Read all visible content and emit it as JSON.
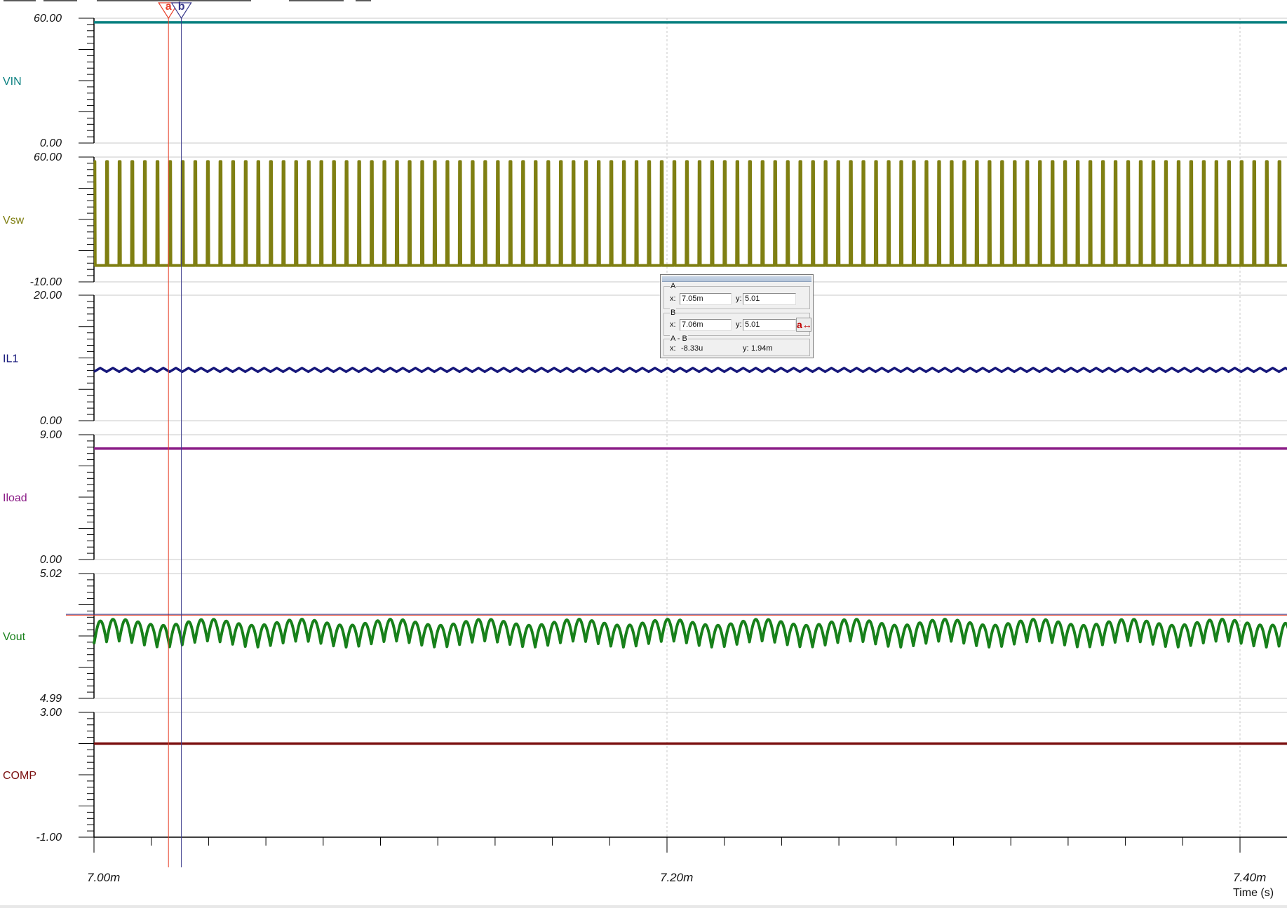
{
  "window": {
    "x_axis_title": "Time (s)"
  },
  "colors": {
    "grid": "#c8c8c8",
    "axis": "#000000",
    "cursor_a": "#e8402a",
    "cursor_b": "#3a3a8c",
    "VIN": "#0a8080",
    "Vsw": "#7f7f12",
    "IL1": "#15167a",
    "Iload": "#8a1a86",
    "Vout": "#17801a",
    "COMP": "#7a0e0e"
  },
  "chart_data": {
    "type": "line",
    "x_unit": "s",
    "x_range": [
      0.007,
      0.00743
    ],
    "x_ticks": [
      {
        "value": 0.007,
        "label": "7.00m"
      },
      {
        "value": 0.0072,
        "label": "7.20m"
      },
      {
        "value": 0.0074,
        "label": "7.40m"
      }
    ],
    "x_minor_step": 2e-05,
    "switching_period": 4.4e-06,
    "channels": [
      {
        "name": "VIN",
        "y_max": 60.0,
        "y_min": 0.0,
        "y_max_label": "60.00",
        "y_min_label": "0.00",
        "color_key": "VIN",
        "kind": "dc",
        "dc": 58.0
      },
      {
        "name": "Vsw",
        "y_max": 60.0,
        "y_min": -10.0,
        "y_max_label": "60.00",
        "y_min_label": "-10.00",
        "color_key": "Vsw",
        "kind": "pulse",
        "high": 57.5,
        "low": -0.8,
        "duty": 0.09
      },
      {
        "name": "IL1",
        "y_max": 20.0,
        "y_min": 0.0,
        "y_max_label": "20.00",
        "y_min_label": "0.00",
        "color_key": "IL1",
        "kind": "sawtooth",
        "mean": 8.1,
        "ripple": 0.6
      },
      {
        "name": "Iload",
        "y_max": 9.0,
        "y_min": 0.0,
        "y_max_label": "9.00",
        "y_min_label": "0.00",
        "color_key": "Iload",
        "kind": "dc",
        "dc": 8.0
      },
      {
        "name": "Vout",
        "y_max": 5.02,
        "y_min": 4.99,
        "y_max_label": "5.02",
        "y_min_label": "4.99",
        "color_key": "Vout",
        "kind": "ripple",
        "mean": 5.0055,
        "amplitude": 0.0035
      },
      {
        "name": "COMP",
        "y_max": 3.0,
        "y_min": -1.0,
        "y_max_label": "3.00",
        "y_min_label": "-1.00",
        "color_key": "COMP",
        "kind": "dc",
        "dc": 2.0
      }
    ],
    "cursors": [
      {
        "name": "a",
        "x": 0.007026,
        "y": 5.01
      },
      {
        "name": "b",
        "x": 0.0070305,
        "y": 5.0102
      }
    ]
  },
  "cursor_panel": {
    "a": {
      "label": "A",
      "x_label": "x:",
      "x_value": "7.05m",
      "y_label": "y:",
      "y_value": "5.01"
    },
    "b": {
      "label": "B",
      "x_label": "x:",
      "x_value": "7.06m",
      "y_label": "y:",
      "y_value": "5.01",
      "swap_label": "a↔"
    },
    "diff": {
      "label": "A - B",
      "x_label": "x:",
      "x_value": "-8.33u",
      "y_label": "y:",
      "y_value": "1.94m"
    }
  }
}
